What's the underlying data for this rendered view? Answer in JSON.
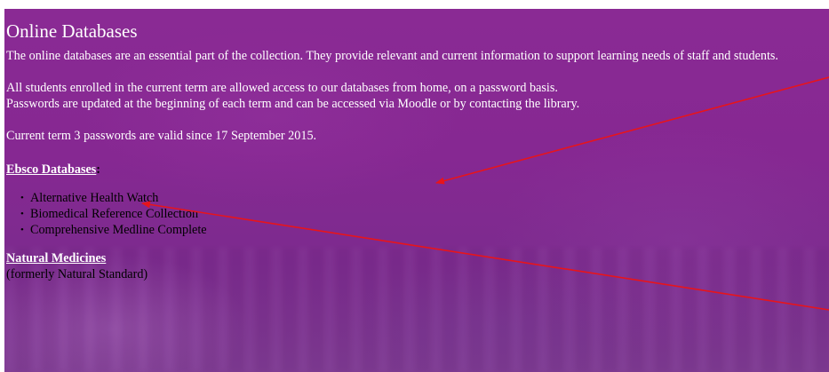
{
  "page": {
    "title": "Online Databases",
    "intro": "The online databases are an essential part of the collection. They provide relevant and current information to support learning needs of staff and students.",
    "access_line1": "All students enrolled in the current term are allowed access to our databases from home, on a password basis.",
    "access_line2": "Passwords are updated at the beginning of each term and can be accessed via Moodle or by contacting the library.",
    "passwords_note": "Current term 3 passwords are valid since 17 September 2015."
  },
  "ebsco": {
    "heading": "Ebsco Databases",
    "colon": ":",
    "items": [
      "Alternative Health Watch",
      "Biomedical Reference Collection",
      "Comprehensive Medline Complete"
    ]
  },
  "natural_medicines": {
    "heading": "Natural Medicines",
    "subtitle": "(formerly Natural Standard)"
  },
  "annotation_color": "#e8141b"
}
